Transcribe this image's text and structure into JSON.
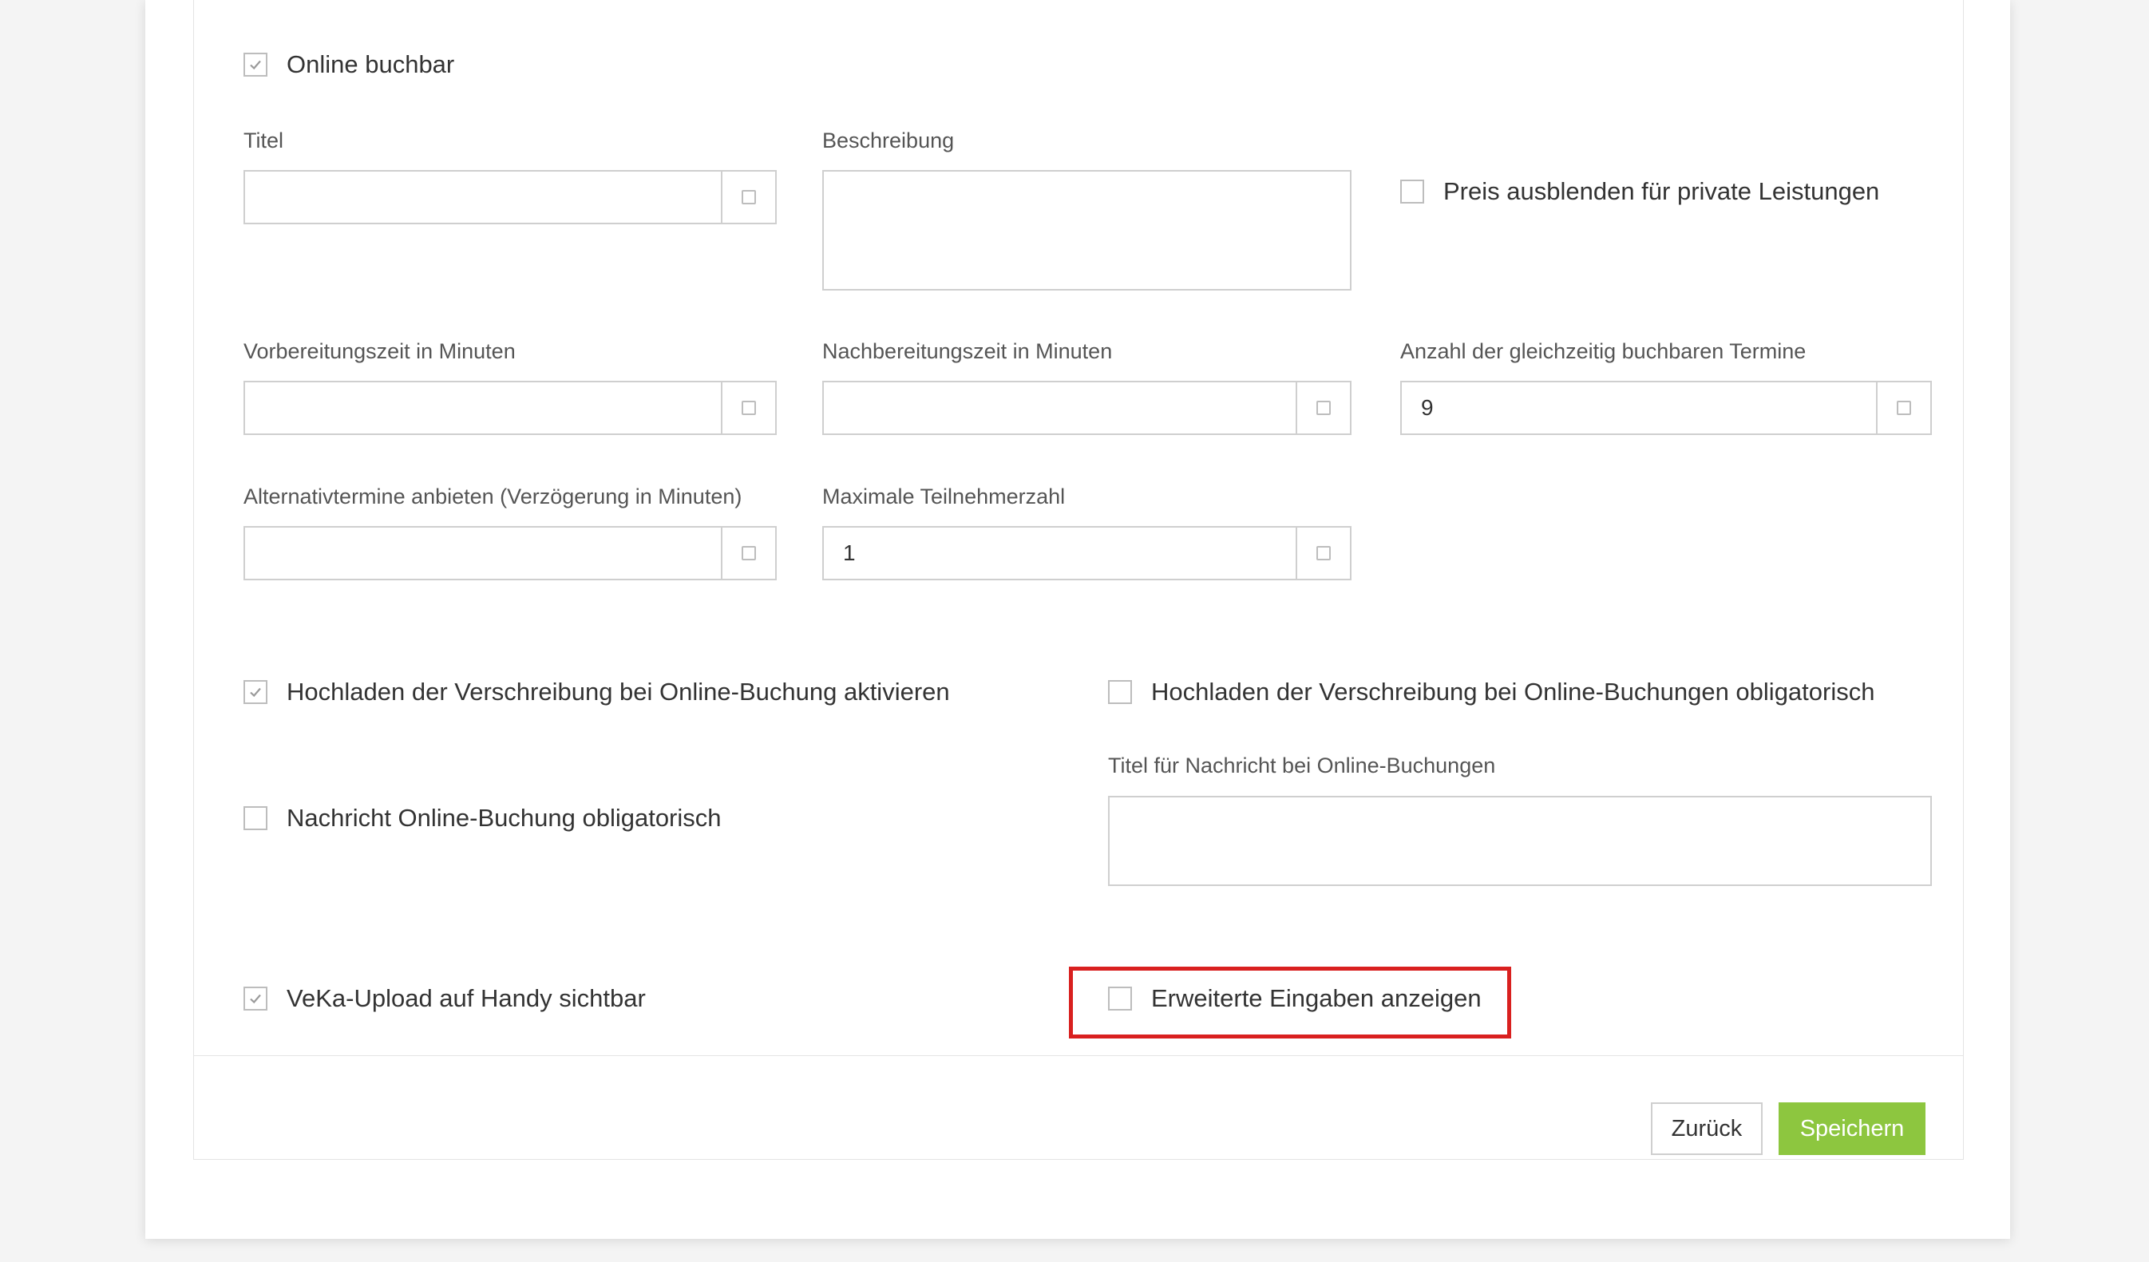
{
  "online_buchbar": {
    "label": "Online buchbar",
    "checked": true
  },
  "titel": {
    "label": "Titel",
    "value": ""
  },
  "beschreibung": {
    "label": "Beschreibung",
    "value": ""
  },
  "preis_ausblenden": {
    "label": "Preis ausblenden für private Leistungen",
    "checked": false
  },
  "vorbereitungszeit": {
    "label": "Vorbereitungszeit in Minuten",
    "value": ""
  },
  "nachbereitungszeit": {
    "label": "Nachbereitungszeit in Minuten",
    "value": ""
  },
  "anzahl_termine": {
    "label": "Anzahl der gleichzeitig buchbaren Termine",
    "value": "9"
  },
  "alternativtermine": {
    "label": "Alternativtermine anbieten (Verzögerung in Minuten)",
    "value": ""
  },
  "max_teilnehmer": {
    "label": "Maximale Teilnehmerzahl",
    "value": "1"
  },
  "upload_aktivieren": {
    "label": "Hochladen der Verschreibung bei Online-Buchung aktivieren",
    "checked": true
  },
  "upload_obligatorisch": {
    "label": "Hochladen der Verschreibung bei Online-Buchungen obligatorisch",
    "checked": false
  },
  "nachricht_obligatorisch": {
    "label": "Nachricht Online-Buchung obligatorisch",
    "checked": false
  },
  "titel_nachricht": {
    "label": "Titel für Nachricht bei Online-Buchungen",
    "value": ""
  },
  "veka_upload": {
    "label": "VeKa-Upload auf Handy sichtbar",
    "checked": true
  },
  "erweiterte_eingaben": {
    "label": "Erweiterte Eingaben anzeigen",
    "checked": false
  },
  "buttons": {
    "back": "Zurück",
    "save": "Speichern"
  },
  "colors": {
    "accent": "#8dc63f",
    "highlight": "#d9201f"
  }
}
